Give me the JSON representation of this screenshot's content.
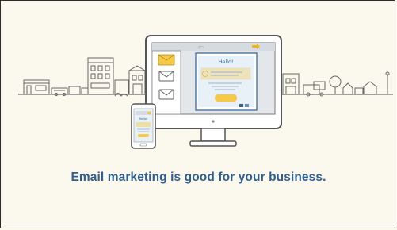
{
  "tagline": "Email marketing is good for your business.",
  "screen_email_heading": "Hello!",
  "phone_email_heading": "Hello!",
  "colors": {
    "accent_blue": "#2f5f93",
    "accent_yellow": "#f7c948",
    "line_gray": "#666666",
    "paper": "#fbf8ee"
  },
  "icons": [
    "desktop-monitor",
    "smartphone",
    "envelope-icon",
    "arrow-icon",
    "city-skyline"
  ]
}
